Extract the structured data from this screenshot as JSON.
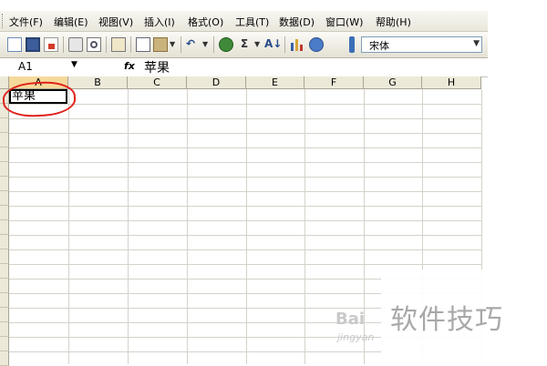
{
  "menu": [
    "文件(F)",
    "编辑(E)",
    "视图(V)",
    "插入(I)",
    "格式(O)",
    "工具(T)",
    "数据(D)",
    "窗口(W)",
    "帮助(H)"
  ],
  "toolbar": {
    "icons": [
      "new-file-icon",
      "save-icon",
      "permission-icon",
      "print-icon",
      "print-preview-icon",
      "spell-check-icon",
      "copy-icon",
      "paste-icon",
      "undo-icon",
      "hyperlink-icon",
      "autosum-icon",
      "sort-icon",
      "chart-icon",
      "help-icon"
    ],
    "autosum_symbol": "Σ",
    "font_name": "宋体"
  },
  "formula_bar": {
    "name_box": "A1",
    "fx_label": "fx",
    "value": "苹果"
  },
  "sheet": {
    "columns": [
      "A",
      "B",
      "C",
      "D",
      "E",
      "F",
      "G",
      "H"
    ],
    "active_cell": "A1",
    "cell_a1": "苹果"
  },
  "watermark": {
    "text": "软件技巧",
    "baidu": "Bai",
    "sub": "jingyan"
  },
  "colors": {
    "annotation_circle": "#e0201c",
    "selected_header": "#f5d99b"
  }
}
